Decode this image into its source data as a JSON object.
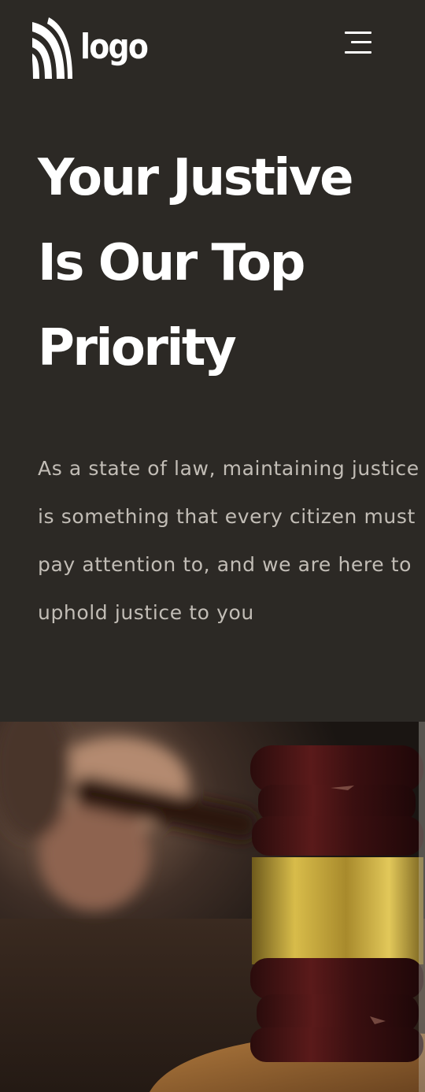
{
  "header": {
    "logo_text": "logo",
    "logo_icon": "stripes-logo-icon",
    "menu_icon": "hamburger-menu-icon"
  },
  "hero": {
    "title": "Your Justive Is Our Top Priority",
    "description": "As a state of law, maintaining justice is something that every citizen must pay attention to, and we are here to uphold justice to you",
    "image": "judge-gavel-photo"
  },
  "colors": {
    "background": "#2c2925",
    "title": "#ffffff",
    "body_text": "#c2bdb6",
    "gavel_band": "#c9a53a"
  }
}
